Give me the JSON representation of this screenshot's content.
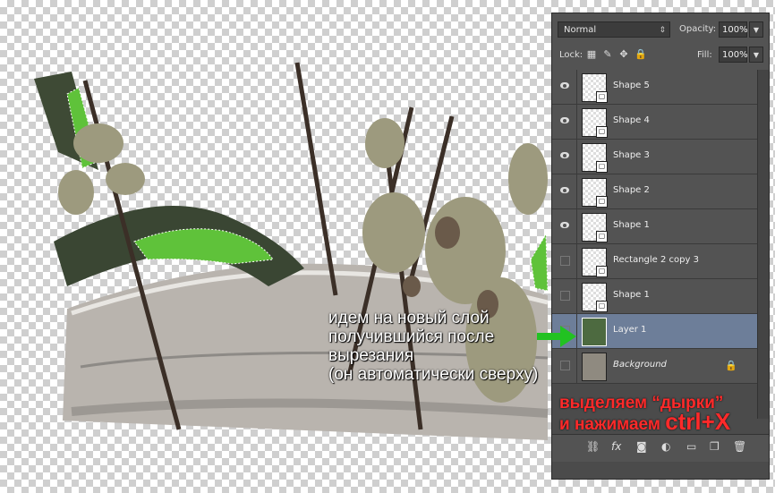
{
  "panel": {
    "blend_mode": "Normal",
    "opacity_label": "Opacity:",
    "opacity_value": "100%",
    "lock_label": "Lock:",
    "fill_label": "Fill:",
    "fill_value": "100%",
    "layers": [
      {
        "name": "Shape 5",
        "visible": true
      },
      {
        "name": "Shape 4",
        "visible": true
      },
      {
        "name": "Shape 3",
        "visible": true
      },
      {
        "name": "Shape 2",
        "visible": true
      },
      {
        "name": "Shape 1",
        "visible": true
      },
      {
        "name": "Rectangle 2 copy 3",
        "visible": false
      },
      {
        "name": "Shape 1",
        "visible": false
      },
      {
        "name": "Layer 1",
        "visible": false,
        "selected": true
      },
      {
        "name": "Background",
        "visible": false,
        "locked": true
      }
    ],
    "bottom_icons": [
      "link-icon",
      "fx-icon",
      "mask-icon",
      "adjustment-icon",
      "folder-icon",
      "new-layer-icon",
      "trash-icon"
    ]
  },
  "annotations": {
    "note1_lines": [
      "идем на новый слой",
      "получившийся после",
      "вырезания",
      "(он автоматически сверху)"
    ],
    "note2_line1": "выделяем “дырки”",
    "note2_line2": "и нажимаем",
    "note2_shortcut": "ctrl+X"
  },
  "colors": {
    "selection_green": "#5fc23a",
    "selected_layer": "#6d7e99",
    "arrow": "#22c222",
    "note_red": "#ff2a2a"
  }
}
